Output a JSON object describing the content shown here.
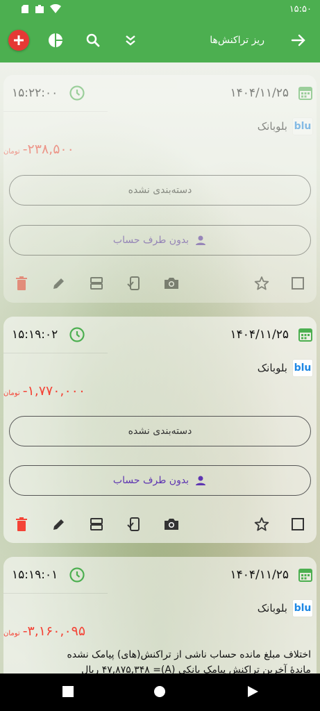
{
  "status": {
    "time": "۱۵:۵۰"
  },
  "appbar": {
    "title": "ریز تراکنش‌ها",
    "back_icon": "arrow-forward-icon",
    "actions": [
      "add-icon",
      "pie-chart-icon",
      "search-icon",
      "expand-all-icon"
    ]
  },
  "colors": {
    "green": "#4caf50",
    "red": "#f44336",
    "purple": "#5e35b1"
  },
  "transactions": [
    {
      "time": "۱۵:۲۲:۰۰",
      "date": "۱۴۰۴/۱۱/۲۵",
      "bank": "بلوبانک",
      "bank_logo": "blu",
      "amount": "-۲۳۸,۵۰۰",
      "currency": "تومان",
      "category": "دسته‌بندی نشده",
      "counterparty": "بدون طرف حساب"
    },
    {
      "time": "۱۵:۱۹:۰۲",
      "date": "۱۴۰۴/۱۱/۲۵",
      "bank": "بلوبانک",
      "bank_logo": "blu",
      "amount": "-۱,۷۷۰,۰۰۰",
      "currency": "تومان",
      "category": "دسته‌بندی نشده",
      "counterparty": "بدون طرف حساب"
    },
    {
      "time": "۱۵:۱۹:۰۱",
      "date": "۱۴۰۴/۱۱/۲۵",
      "bank": "بلوبانک",
      "bank_logo": "blu",
      "amount": "-۳,۱۶۰,۰۹۵",
      "currency": "تومان",
      "description_line1": "اختلاف مبلغ مانده حساب ناشی از تراکنش(های) پیامک نشده",
      "description_line2": "ماندهٔ آخرین تراکنش پیامک بانکی (A)= ۴۷,۸۷۵,۳۴۸ ریال"
    }
  ]
}
